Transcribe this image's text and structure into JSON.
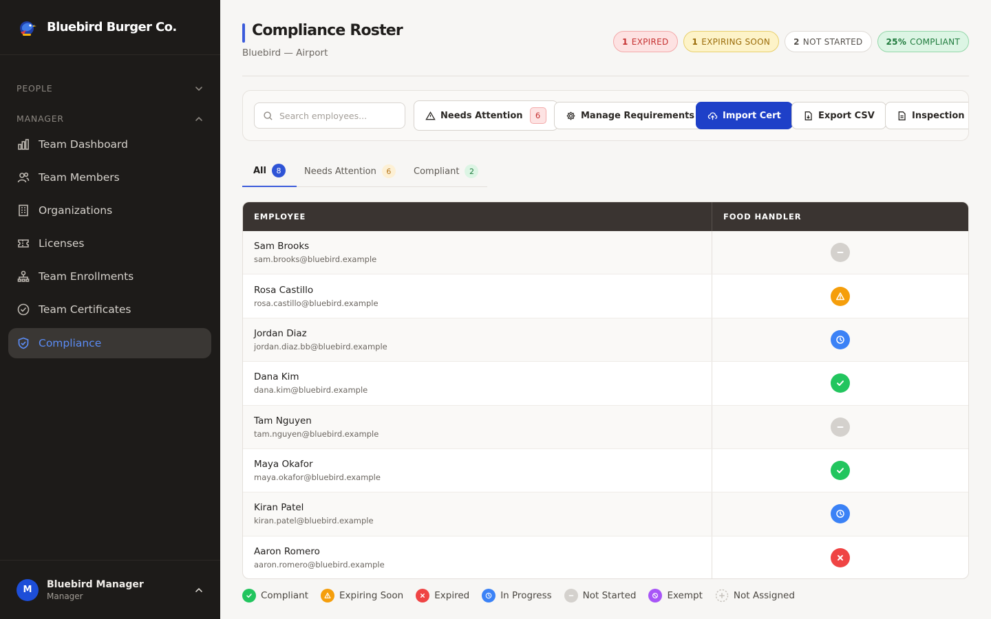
{
  "brand": {
    "name": "Bluebird Burger Co."
  },
  "sidebar": {
    "sections": [
      {
        "label": "PEOPLE",
        "state": "collapsed"
      },
      {
        "label": "MANAGER",
        "state": "expanded"
      }
    ],
    "items": [
      {
        "label": "Team Dashboard",
        "icon": "bar-chart-icon"
      },
      {
        "label": "Team Members",
        "icon": "users-icon"
      },
      {
        "label": "Organizations",
        "icon": "building-icon"
      },
      {
        "label": "Licenses",
        "icon": "ticket-icon"
      },
      {
        "label": "Team Enrollments",
        "icon": "org-chart-icon"
      },
      {
        "label": "Team Certificates",
        "icon": "check-circle-icon"
      },
      {
        "label": "Compliance",
        "icon": "shield-check-icon",
        "active": true
      }
    ],
    "user": {
      "initial": "M",
      "name": "Bluebird Manager",
      "role": "Manager"
    }
  },
  "header": {
    "title": "Compliance Roster",
    "subtitle": "Bluebird — Airport",
    "badges": [
      {
        "count": "1",
        "label": "EXPIRED"
      },
      {
        "count": "1",
        "label": "EXPIRING SOON"
      },
      {
        "count": "2",
        "label": "NOT STARTED"
      },
      {
        "count": "25%",
        "label": "COMPLIANT"
      }
    ]
  },
  "toolbar": {
    "search_placeholder": "Search employees...",
    "needs_attention_label": "Needs Attention",
    "needs_attention_count": "6",
    "manage_label": "Manage Requirements",
    "import_label": "Import Cert",
    "export_label": "Export CSV",
    "inspection_label": "Inspection Pa"
  },
  "tabs": [
    {
      "label": "All",
      "count": "8",
      "active": true
    },
    {
      "label": "Needs Attention",
      "count": "6"
    },
    {
      "label": "Compliant",
      "count": "2"
    }
  ],
  "table": {
    "columns": [
      "EMPLOYEE",
      "FOOD HANDLER"
    ],
    "rows": [
      {
        "name": "Sam Brooks",
        "email": "sam.brooks@bluebird.example",
        "status": "not-started"
      },
      {
        "name": "Rosa Castillo",
        "email": "rosa.castillo@bluebird.example",
        "status": "expiring-soon"
      },
      {
        "name": "Jordan Diaz",
        "email": "jordan.diaz.bb@bluebird.example",
        "status": "in-progress"
      },
      {
        "name": "Dana Kim",
        "email": "dana.kim@bluebird.example",
        "status": "compliant"
      },
      {
        "name": "Tam Nguyen",
        "email": "tam.nguyen@bluebird.example",
        "status": "not-started"
      },
      {
        "name": "Maya Okafor",
        "email": "maya.okafor@bluebird.example",
        "status": "compliant"
      },
      {
        "name": "Kiran Patel",
        "email": "kiran.patel@bluebird.example",
        "status": "in-progress"
      },
      {
        "name": "Aaron Romero",
        "email": "aaron.romero@bluebird.example",
        "status": "expired"
      }
    ]
  },
  "legend": [
    {
      "label": "Compliant",
      "status": "compliant"
    },
    {
      "label": "Expiring Soon",
      "status": "expiring-soon"
    },
    {
      "label": "Expired",
      "status": "expired"
    },
    {
      "label": "In Progress",
      "status": "in-progress"
    },
    {
      "label": "Not Started",
      "status": "not-started"
    },
    {
      "label": "Exempt",
      "status": "exempt"
    },
    {
      "label": "Not Assigned",
      "status": "not-assigned"
    }
  ],
  "colors": {
    "compliant": "#22c55e",
    "expiring-soon": "#f59e0b",
    "expired": "#ef4444",
    "in-progress": "#3b82f6",
    "not-started": "#d4d1cd",
    "exempt": "#a855f7",
    "accent": "#1e40c8"
  }
}
